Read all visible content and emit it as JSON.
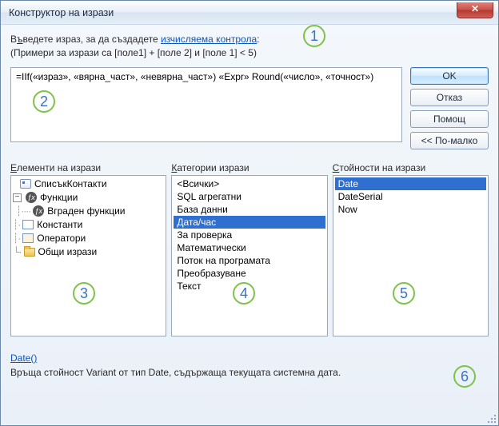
{
  "window": {
    "title": "Конструктор на изрази",
    "close_tooltip": "Close"
  },
  "intro": {
    "line1_prefix": "В",
    "line1_u1": "ъ",
    "line1_mid": "ведете израз, за да създадете ",
    "line1_link": "изчисляема контрола",
    "line1_suffix": ":",
    "line2": "(Примери за изрази са [поле1] + [поле 2] и [поле 1] < 5)"
  },
  "expression": "=IIf(«израз», «вярна_част», «невярна_част») «Expr» Round(«число», «точност»)",
  "buttons": {
    "ok": "OK",
    "cancel": "Отказ",
    "help": "Помощ",
    "less": "<< По-малко"
  },
  "panes": {
    "elements": {
      "label_u": "Е",
      "label_rest": "лементи на изрази"
    },
    "categories": {
      "label_u": "К",
      "label_rest": "атегории изрази"
    },
    "values": {
      "label_u": "С",
      "label_rest": "тойности на изрази"
    }
  },
  "tree": {
    "item0": "СписъкКонтакти",
    "item1": "Функции",
    "item1_0": "Вграден функции",
    "item2": "Константи",
    "item3": "Оператори",
    "item4": "Общи изрази"
  },
  "categories": [
    "<Всички>",
    "SQL агрегатни",
    "База данни",
    "Дата/час",
    "За проверка",
    "Математически",
    "Поток на програмата",
    "Преобразуване",
    "Текст"
  ],
  "categories_selected": 3,
  "values": [
    "Date",
    "DateSerial",
    "Now"
  ],
  "values_selected": 0,
  "description": {
    "link": "Date()",
    "text": "Връща стойност Variant от тип Date, съдържаща текущата системна дата."
  },
  "callouts": {
    "c1": "1",
    "c2": "2",
    "c3": "3",
    "c4": "4",
    "c5": "5",
    "c6": "6"
  }
}
